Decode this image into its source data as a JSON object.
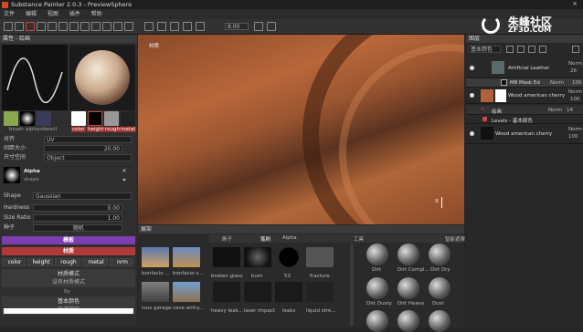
{
  "title": "Substance Painter 2.0.3 - PreviewSphere",
  "menu": [
    "文件",
    "编辑",
    "视图",
    "插件",
    "帮助"
  ],
  "watermark": {
    "brand": "朱峰社区",
    "url": "ZF3D.COM"
  },
  "toolbar": {
    "value": "8.00"
  },
  "left": {
    "header": "属性 - 绘画",
    "brush_labels": [
      "brush",
      "alpha",
      "stencil"
    ],
    "channel_chips": [
      "color",
      "height",
      "rough",
      "metal"
    ],
    "rows": [
      {
        "label": "对齐",
        "value": "UV"
      },
      {
        "label": "间距大小",
        "value": "20.00"
      },
      {
        "label": "尺寸空间",
        "value": "Object"
      }
    ],
    "alpha": {
      "name": "Alpha",
      "sub": "shape"
    },
    "shape": {
      "label": "Shape",
      "value": "Gaussian"
    },
    "hardness": {
      "label": "Hardness",
      "value": "0.00"
    },
    "size_ratio": {
      "label": "Size Ratio",
      "value": "1.00"
    },
    "seed": {
      "label": "种子",
      "value": "随机"
    },
    "stencil_header": "模板",
    "material_header": "材质",
    "channels": [
      "color",
      "height",
      "rough",
      "metal",
      "nrm"
    ],
    "mat_mode": "材质模式",
    "mat_none": "没有材质模式",
    "mat_sub": "0y",
    "base_color": "基本颜色",
    "base_sub": "急速因均"
  },
  "viewport": {
    "label": "材质",
    "axis": "X"
  },
  "right": {
    "header": "图层",
    "blend": "基本颜色",
    "layers": [
      {
        "name": "Artificial Leather",
        "mode": "Norm",
        "val": "26"
      },
      {
        "name": "M8 Mask Ed",
        "mode": "Norm",
        "val": "100"
      },
      {
        "name": "Wood american cherry",
        "mode": "Norm",
        "val": "100"
      },
      {
        "name": "绘画",
        "mode": "Norm",
        "val": "14"
      },
      {
        "name": "Levels - 基本颜色",
        "mode": "",
        "val": ""
      },
      {
        "name": "Wood american cherry",
        "mode": "Norm",
        "val": "100"
      }
    ]
  },
  "shelf": {
    "header": "展架",
    "tabs": [
      "刷子",
      "笔刷",
      "Alpha",
      "工具",
      "智能遮罩"
    ],
    "env": [
      "bonfacio ...",
      "bonfacio s...",
      "ious garage",
      "cave entry..."
    ],
    "alphas": [
      "broken glass",
      "burn",
      "53",
      "fracture",
      "heavy leak...",
      "laser impact",
      "leaks",
      "liquid stre..."
    ],
    "mats": [
      "Dirt",
      "Dirt Compl...",
      "Dirt Dry",
      "Dirt Dusty",
      "Dirt Heavy",
      "Dust"
    ]
  },
  "colors": {
    "stencil_bar": "#7d3fb0",
    "material_bar": "#b03a3a",
    "accent": "#2e7bc9"
  }
}
